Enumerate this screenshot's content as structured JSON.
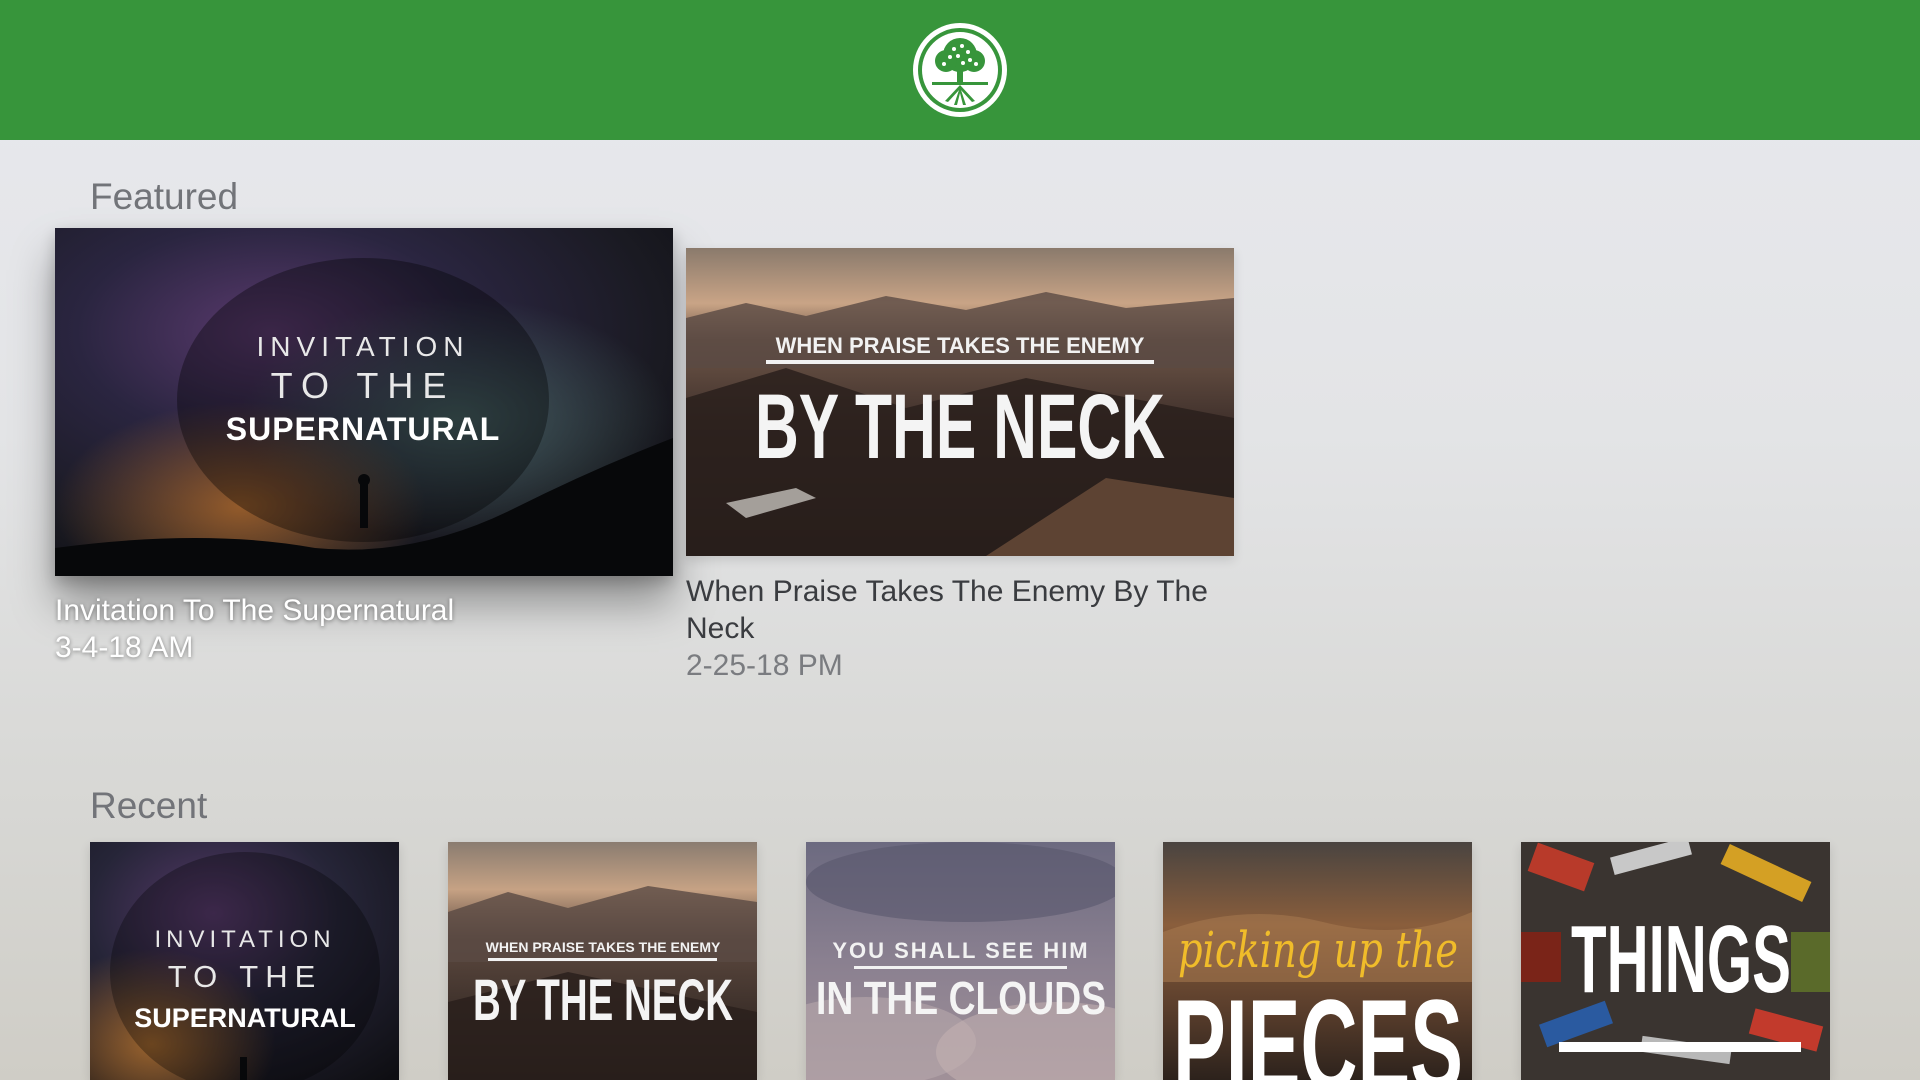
{
  "header": {
    "logo_icon": "tree-of-life-icon",
    "bar_color": "#37953b"
  },
  "featured": {
    "heading": "Featured",
    "items": [
      {
        "title": "Invitation To The Supernatural",
        "date": "3-4-18 AM",
        "art": {
          "line1": "INVITATION",
          "line2": "TO THE",
          "line3": "SUPERNATURAL"
        },
        "focused": true
      },
      {
        "title": "When Praise Takes The Enemy By The Neck",
        "date": "2-25-18 PM",
        "art": {
          "line1": "WHEN PRAISE TAKES THE ENEMY",
          "line2": "BY THE NECK"
        },
        "focused": false
      }
    ]
  },
  "recent": {
    "heading": "Recent",
    "items": [
      {
        "art": {
          "line1": "INVITATION",
          "line2": "TO THE",
          "line3": "SUPERNATURAL"
        }
      },
      {
        "art": {
          "line1": "WHEN PRAISE TAKES THE ENEMY",
          "line2": "BY THE NECK"
        }
      },
      {
        "art": {
          "line1": "YOU SHALL SEE HIM",
          "line2": "IN THE CLOUDS"
        }
      },
      {
        "art": {
          "line1": "picking up the",
          "line2": "PIECES"
        }
      },
      {
        "art": {
          "line1": "THINGS"
        }
      }
    ]
  }
}
